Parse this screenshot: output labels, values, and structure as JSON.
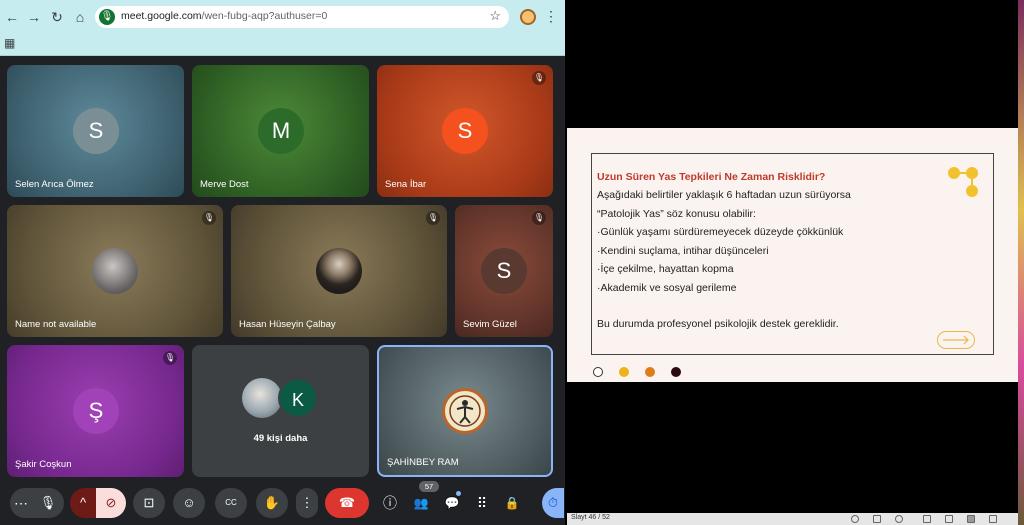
{
  "browser": {
    "url_host": "meet.google.com",
    "url_path": "/wen-fubg-aqp?authuser=0",
    "nav": {
      "back": "←",
      "forward": "→",
      "reload": "↻",
      "home": "⌂"
    },
    "star": "☆",
    "menu": "⋮",
    "apps": "▦",
    "site_icon": "🎙",
    "colors": {
      "chrome": "#c7ecef"
    }
  },
  "meet": {
    "tiles": [
      {
        "name": "Selen Arıca Ölmez",
        "initial": "S",
        "avatar_color": "#7a8e96",
        "muted": false
      },
      {
        "name": "Merve Dost",
        "initial": "M",
        "avatar_color": "#2d6b2a",
        "muted": false
      },
      {
        "name": "Sena İbar",
        "initial": "S",
        "avatar_color": "#f4511e",
        "muted": true
      },
      {
        "name": "Name not available",
        "initial": "",
        "muted": true
      },
      {
        "name": "Hasan Hüseyin Çalbay",
        "initial": "",
        "muted": true
      },
      {
        "name": "Sevim Güzel",
        "initial": "S",
        "avatar_color": "#5a3a30",
        "muted": true
      },
      {
        "name": "Şakir Coşkun",
        "initial": "Ş",
        "avatar_color": "#a142b8",
        "muted": true
      },
      {
        "name": "49 kişi daha",
        "initial": "K",
        "avatar_color": "#0b5a45",
        "muted": false
      },
      {
        "name": "ŞAHİNBEY RAM",
        "initial": "",
        "muted": false
      }
    ],
    "mute_glyph": "🎙"
  },
  "toolbar": {
    "more_options": "⋯",
    "mic": "🎙",
    "chevron": "^",
    "camera": "⊘",
    "present": "⊡",
    "emoji": "☺",
    "captions": "CC",
    "raise_hand": "✋",
    "more": "⋮",
    "end_call": "☎",
    "info": "ⓘ",
    "people": "👥",
    "people_count": "57",
    "chat": "💬",
    "activities": "⠿",
    "host_controls": "🔒",
    "timer": "⏱"
  },
  "slide": {
    "title": "Uzun Süren Yas Tepkileri Ne Zaman Risklidir?",
    "lines": [
      " Aşağıdaki belirtiler yaklaşık  6 haftadan uzun sürüyorsa",
      "“Patolojik Yas” söz konusu olabilir:",
      "·Günlük yaşamı sürdüremeyecek düzeyde çökkünlük",
      "·Kendini suçlama, intihar düşünceleri",
      "·İçe çekilme, hayattan kopma",
      "·Akademik ve sosyal gerileme",
      "",
      "Bu durumda profesyonel psikolojik destek gereklidir."
    ],
    "dot_colors": [
      "#ffffff",
      "#f2b01e",
      "#e07b1a",
      "#2a0a12"
    ],
    "accent": "#c0392b",
    "deco_color": "#f2c12e"
  },
  "status_bar": {
    "slide_count": "Slayt 46 / 52"
  }
}
